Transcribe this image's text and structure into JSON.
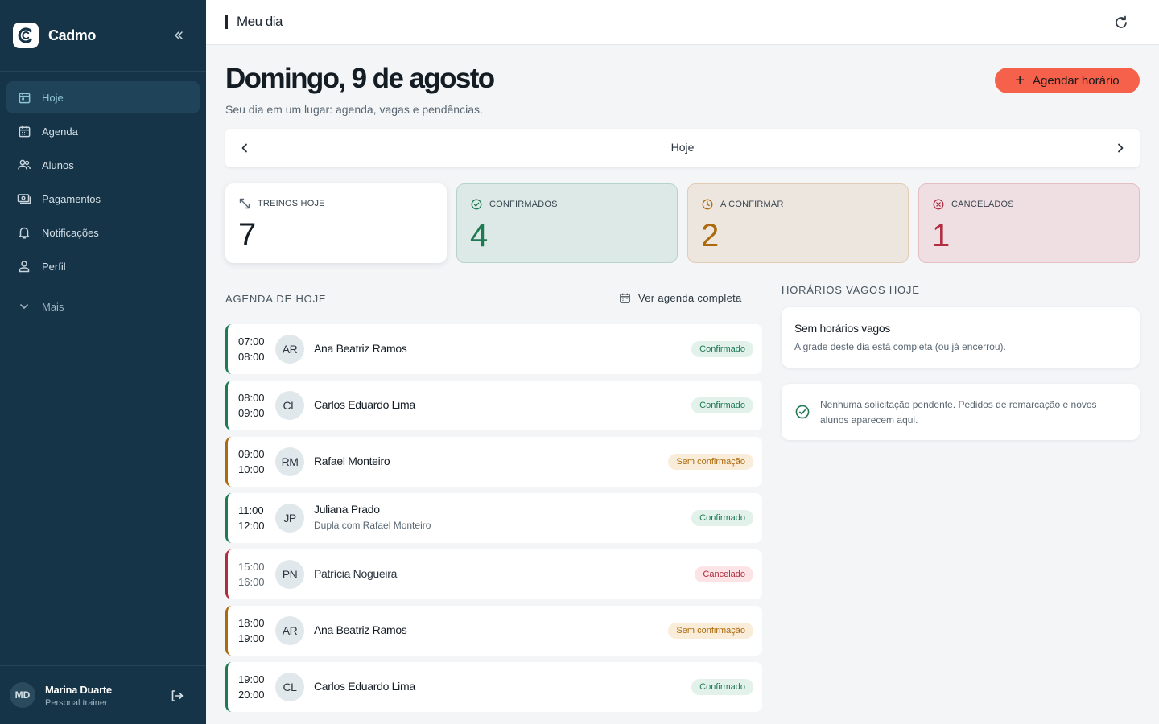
{
  "app": {
    "name": "Cadmo"
  },
  "sidebar": {
    "items": [
      {
        "label": "Hoje",
        "icon": "calendar-day-icon",
        "active": true
      },
      {
        "label": "Agenda",
        "icon": "calendar-icon"
      },
      {
        "label": "Alunos",
        "icon": "users-icon"
      },
      {
        "label": "Pagamentos",
        "icon": "money-icon"
      },
      {
        "label": "Notificações",
        "icon": "bell-icon"
      },
      {
        "label": "Perfil",
        "icon": "user-icon"
      }
    ],
    "more_label": "Mais"
  },
  "user": {
    "initials": "MD",
    "name": "Marina Duarte",
    "role": "Personal trainer"
  },
  "topbar": {
    "title": "Meu dia"
  },
  "header": {
    "title": "Domingo, 9 de agosto",
    "subtitle": "Seu dia em um lugar: agenda, vagas e pendências.",
    "add_label": "Agendar horário"
  },
  "date_nav": {
    "label": "Hoje"
  },
  "stats": {
    "total": {
      "label": "TREINOS HOJE",
      "value": "7"
    },
    "confirmed": {
      "label": "CONFIRMADOS",
      "value": "4"
    },
    "pending": {
      "label": "A CONFIRMAR",
      "value": "2"
    },
    "cancelled": {
      "label": "CANCELADOS",
      "value": "1"
    }
  },
  "agenda": {
    "label": "AGENDA DE HOJE",
    "see_all": "Ver agenda completa",
    "rows": [
      {
        "start": "07:00",
        "end": "08:00",
        "initials": "AR",
        "name": "Ana Beatriz Ramos",
        "note": "",
        "status": "Confirmado"
      },
      {
        "start": "08:00",
        "end": "09:00",
        "initials": "CL",
        "name": "Carlos Eduardo Lima",
        "note": "",
        "status": "Confirmado"
      },
      {
        "start": "09:00",
        "end": "10:00",
        "initials": "RM",
        "name": "Rafael Monteiro",
        "note": "",
        "status": "Sem confirmação"
      },
      {
        "start": "11:00",
        "end": "12:00",
        "initials": "JP",
        "name": "Juliana Prado",
        "note": "Dupla com Rafael Monteiro",
        "status": "Confirmado"
      },
      {
        "start": "15:00",
        "end": "16:00",
        "initials": "PN",
        "name": "Patrícia Nogueira",
        "note": "",
        "status": "Cancelado"
      },
      {
        "start": "18:00",
        "end": "19:00",
        "initials": "AR",
        "name": "Ana Beatriz Ramos",
        "note": "",
        "status": "Sem confirmação"
      },
      {
        "start": "19:00",
        "end": "20:00",
        "initials": "CL",
        "name": "Carlos Eduardo Lima",
        "note": "",
        "status": "Confirmado"
      }
    ]
  },
  "vacancies": {
    "label": "HORÁRIOS VAGOS HOJE",
    "empty_title": "Sem horários vagos",
    "empty_text": "A grade deste dia está completa (ou já encerrou)."
  },
  "requests": {
    "text": "Nenhuma solicitação pendente. Pedidos de remarcação e novos alunos aparecem aqui."
  },
  "colors": {
    "sidebar": "#163448",
    "accent": "#f5614a",
    "confirmed": "#1e7a52",
    "pending": "#ad6a0c",
    "cancelled": "#b02c3e"
  }
}
